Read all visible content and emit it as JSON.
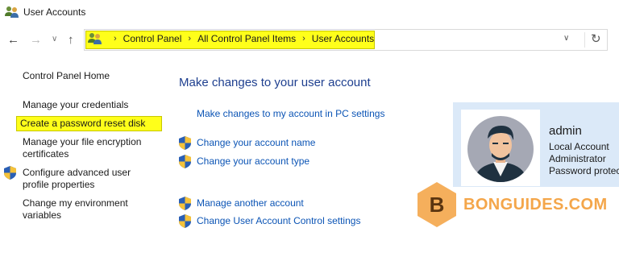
{
  "window": {
    "title": "User Accounts"
  },
  "breadcrumbs": [
    "Control Panel",
    "All Control Panel Items",
    "User Accounts"
  ],
  "sidebar": {
    "items": [
      {
        "label": "Control Panel Home"
      },
      {
        "label": "Manage your credentials"
      },
      {
        "label": "Create a password reset disk"
      },
      {
        "label": "Manage your file encryption certificates"
      },
      {
        "label": "Configure advanced user profile properties"
      },
      {
        "label": "Change my environment variables"
      }
    ]
  },
  "main": {
    "heading": "Make changes to your user account",
    "pc_settings_link": "Make changes to my account in PC settings",
    "links": [
      "Change your account name",
      "Change your account type",
      "Manage another account",
      "Change User Account Control settings"
    ]
  },
  "account": {
    "name": "admin",
    "type": "Local Account",
    "role": "Administrator",
    "status": "Password protected"
  },
  "watermark": {
    "letter": "B",
    "text": "BONGUIDES.COM"
  },
  "colors": {
    "highlight": "#ffff1a",
    "link": "#0b54b5",
    "heading": "#1e3f8f",
    "card": "#dbe9f8",
    "watermark": "#f4a64a"
  }
}
